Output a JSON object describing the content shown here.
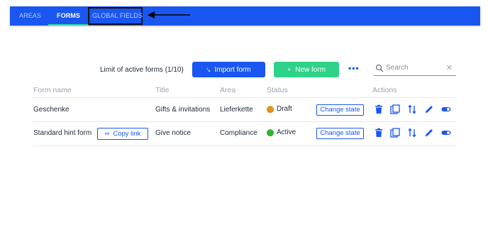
{
  "tabs": [
    {
      "label": "AREAS",
      "active": false
    },
    {
      "label": "FORMS",
      "active": true
    },
    {
      "label": "GLOBAL FIELDS",
      "active": false
    }
  ],
  "toolbar": {
    "limit_text": "Limit of active forms (1/10)",
    "import_label": "Import form",
    "new_label": "New form",
    "more_label": "•••",
    "search_placeholder": "Search"
  },
  "table": {
    "headers": [
      "Form name",
      "Title",
      "Area",
      "Status",
      "Actions"
    ],
    "rows": [
      {
        "name": "Geschenke",
        "title": "Gifts & invitations",
        "area": "Lieferkette",
        "status": "Draft",
        "change_label": "Change state"
      },
      {
        "name": "Standard hint form",
        "copy_label": "Copy link",
        "title": "Give notice",
        "area": "Compliance",
        "status": "Active",
        "change_label": "Change state"
      }
    ]
  },
  "colors": {
    "primary": "#1a56f0",
    "accent_green": "#2ed288",
    "tab_underline": "#33d6a4",
    "draft": "#e3941f",
    "active": "#2cb82c"
  },
  "icons": [
    "search-icon",
    "clear-icon",
    "link-icon",
    "import-icon",
    "plus-icon",
    "delete-icon",
    "duplicate-icon",
    "reorder-icon",
    "edit-icon",
    "toggle-icon",
    "arrow-left-icon"
  ]
}
